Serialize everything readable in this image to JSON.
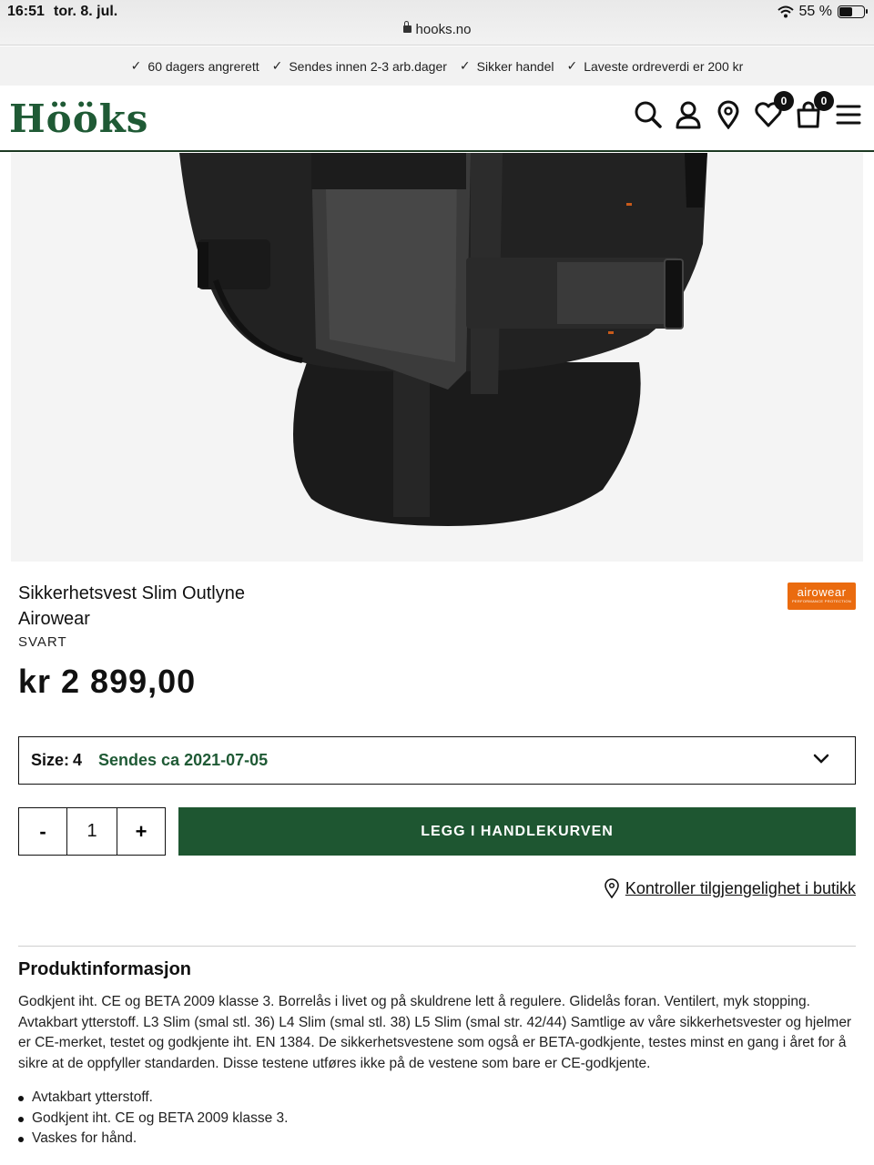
{
  "status_bar": {
    "time": "16:51",
    "date": "tor. 8. jul.",
    "battery": "55 %",
    "battery_level": 0.55,
    "url": "hooks.no"
  },
  "usp_bar": {
    "items": [
      "60 dagers angrerett",
      "Sendes innen 2-3 arb.dager",
      "Sikker handel",
      "Laveste ordreverdi er 200 kr"
    ]
  },
  "header": {
    "logo": "Hööks",
    "wishlist_count": "0",
    "cart_count": "0",
    "icons": [
      "search-icon",
      "account-icon",
      "store-location-icon",
      "wishlist-heart-icon",
      "cart-bag-icon",
      "menu-hamburger-icon"
    ]
  },
  "product": {
    "title_line1": "Sikkerhetsvest Slim Outlyne",
    "title_line2": "Airowear",
    "color": "SVART",
    "price": "kr 2 899,00",
    "brand_logo_text": "airowear",
    "brand_logo_sub": "PERFORMANCE PROTECTION"
  },
  "size_select": {
    "label": "Size:",
    "value": "4",
    "shipping_note": "Sendes ca 2021-07-05"
  },
  "quantity": {
    "minus": "-",
    "value": "1",
    "plus": "+"
  },
  "add_to_cart": "LEGG I HANDLEKURVEN",
  "availability_link": "Kontroller tilgjengelighet i butikk",
  "product_info": {
    "title": "Produktinformasjon",
    "description": "Godkjent iht. CE og BETA 2009 klasse 3. Borrelås i livet og på skuldrene lett å regulere. Glidelås foran. Ventilert, myk stopping. Avtakbart ytterstoff. L3 Slim (smal stl. 36) L4 Slim (smal stl. 38) L5 Slim (smal str. 42/44) Samtlige av våre sikkerhetsvester og hjelmer er CE-merket, testet og godkjente iht. EN 1384. De sikkerhetsvestene som også er BETA-godkjente, testes minst en gang i året for å sikre at de oppfyller standarden. Disse testene utføres ikke på de vestene som bare er CE-godkjente.",
    "bullets": [
      "Avtakbart ytterstoff.",
      "Godkjent iht. CE og BETA 2009 klasse 3.",
      "Vaskes for hånd."
    ]
  }
}
